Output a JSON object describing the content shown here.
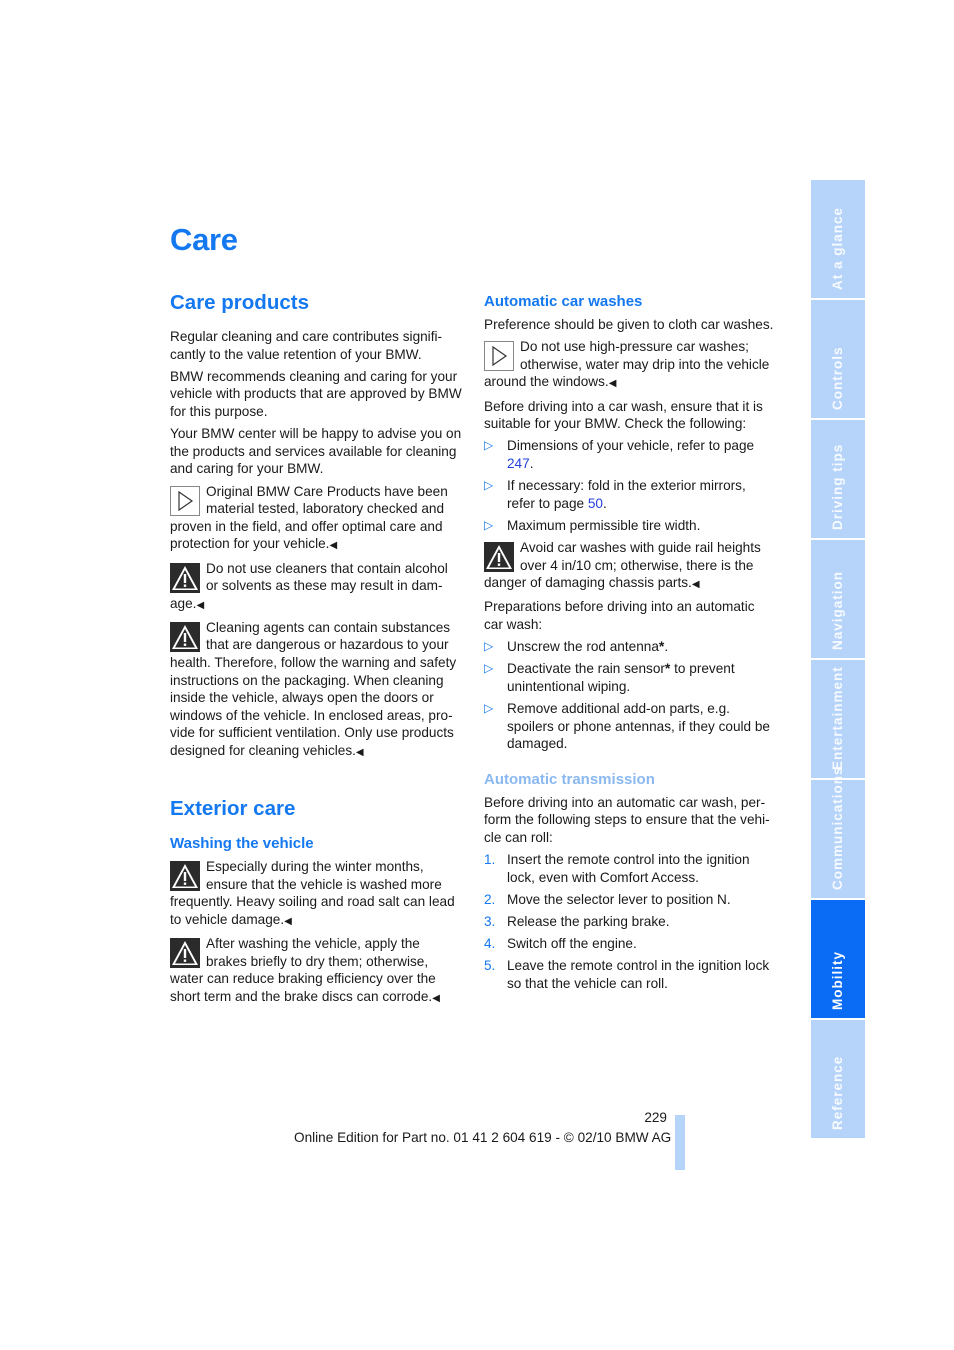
{
  "page": {
    "title": "Care",
    "page_number": "229",
    "footer": "Online Edition for Part no. 01 41 2 604 619 - © 02/10 BMW AG"
  },
  "colors": {
    "heading_blue": "#1478f0",
    "light_heading_blue": "#8ab8f0",
    "tab_inactive": "#b6d4fa",
    "tab_active": "#0a6cf5",
    "link": "#2244dd"
  },
  "sidebar": {
    "tabs": [
      {
        "label": "At a glance",
        "active": false
      },
      {
        "label": "Controls",
        "active": false
      },
      {
        "label": "Driving tips",
        "active": false
      },
      {
        "label": "Navigation",
        "active": false
      },
      {
        "label": "Entertainment",
        "active": false
      },
      {
        "label": "Communications",
        "active": false
      },
      {
        "label": "Mobility",
        "active": true
      },
      {
        "label": "Reference",
        "active": false
      }
    ]
  },
  "care_products": {
    "heading": "Care products",
    "p1": "Regular cleaning and care contributes signifi­cantly to the value retention of your BMW.",
    "p2": "BMW recommends cleaning and caring for your vehicle with products that are approved by BMW for this purpose.",
    "p3": "Your BMW center will be happy to advise you on the products and services available for cleaning and caring for your BMW.",
    "note1": {
      "icon": "note-arrow-icon",
      "text": "Original BMW Care Products have been material tested, laboratory checked and proven in the field, and offer optimal care and protection for your vehicle."
    },
    "warning1": {
      "icon": "warning-triangle-icon",
      "text": "Do not use cleaners that contain alcohol or solvents as these may result in dam­age."
    },
    "warning2": {
      "icon": "warning-triangle-icon",
      "text": "Cleaning agents can contain substances that are dangerous or hazardous to your health. Therefore, follow the warning and safety instructions on the packaging. When cleaning inside the vehicle, always open the doors or windows of the vehicle. In enclosed areas, pro­vide for sufficient ventilation. Only use products designed for cleaning vehicles."
    }
  },
  "exterior_care": {
    "heading": "Exterior care",
    "washing": {
      "heading": "Washing the vehicle",
      "warning1": {
        "icon": "warning-triangle-icon",
        "text": "Especially during the winter months, ensure that the vehicle is washed more frequently. Heavy soiling and road salt can lead to vehicle damage."
      },
      "warning2": {
        "icon": "warning-triangle-icon",
        "text": "After washing the vehicle, apply the brakes briefly to dry them; otherwise, water can reduce braking efficiency over the short term and the brake discs can corrode."
      }
    }
  },
  "automatic_car_washes": {
    "heading": "Automatic car washes",
    "p1": "Preference should be given to cloth car washes.",
    "note1": {
      "icon": "note-arrow-icon",
      "text": "Do not use high-pressure car washes; otherwise, water may drip into the vehicle around the windows."
    },
    "p2": "Before driving into a car wash, ensure that it is suitable for your BMW. Check the following:",
    "checks": [
      {
        "text": "Dimensions of your vehicle, refer to page ",
        "link": "247",
        "after": "."
      },
      {
        "text": "If necessary: fold in the exterior mirrors, refer to page ",
        "link": "50",
        "after": "."
      },
      {
        "text": "Maximum permissible tire width.",
        "link": "",
        "after": ""
      }
    ],
    "warning1": {
      "icon": "warning-triangle-icon",
      "text": "Avoid car washes with guide rail heights over 4 in/10 cm; otherwise, there is the danger of damaging chassis parts."
    },
    "p3": "Preparations before driving into an automatic car wash:",
    "preparations": [
      {
        "text": "Unscrew the rod antenna",
        "star": "*",
        "after": "."
      },
      {
        "text": "Deactivate the rain sensor",
        "star": "*",
        "after": " to prevent unintentional wiping."
      },
      {
        "text": "Remove additional add-on parts, e.g. spoilers or phone antennas, if they could be damaged.",
        "star": "",
        "after": ""
      }
    ]
  },
  "automatic_transmission": {
    "heading": "Automatic transmission",
    "p1": "Before driving into an automatic car wash, per­form the following steps to ensure that the vehi­cle can roll:",
    "steps": [
      {
        "num": "1.",
        "text": "Insert the remote control into the ignition lock, even with Comfort Access."
      },
      {
        "num": "2.",
        "text": "Move the selector lever to position N."
      },
      {
        "num": "3.",
        "text": "Release the parking brake."
      },
      {
        "num": "4.",
        "text": "Switch off the engine."
      },
      {
        "num": "5.",
        "text": "Leave the remote control in the ignition lock so that the vehicle can roll."
      }
    ]
  },
  "glyphs": {
    "end_mark": "◀",
    "bullet": "▷"
  }
}
